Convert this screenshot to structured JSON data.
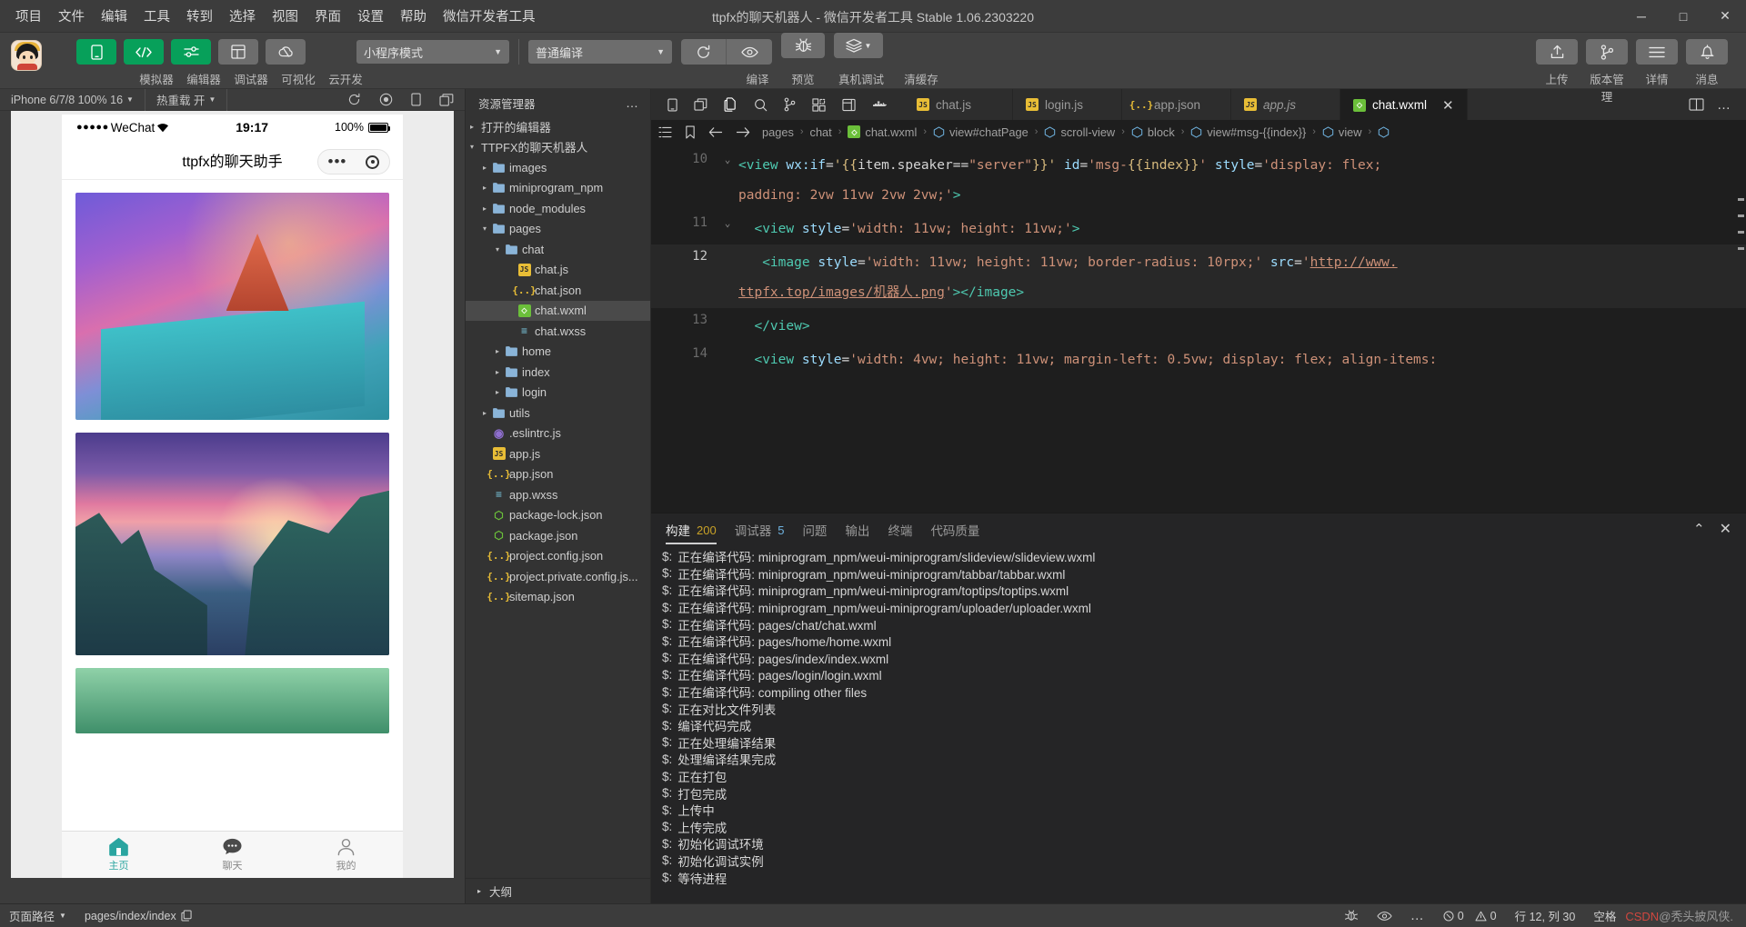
{
  "titlebar": {
    "menu": [
      "项目",
      "文件",
      "编辑",
      "工具",
      "转到",
      "选择",
      "视图",
      "界面",
      "设置",
      "帮助",
      "微信开发者工具"
    ],
    "title": "ttpfx的聊天机器人 - 微信开发者工具 Stable 1.06.2303220",
    "minimize": "─",
    "maximize": "□",
    "close": "✕"
  },
  "toolbar": {
    "left_buttons": [
      {
        "label": "模拟器",
        "icon": "phone-icon",
        "active": true
      },
      {
        "label": "编辑器",
        "icon": "code-icon",
        "active": true
      },
      {
        "label": "调试器",
        "icon": "sliders-icon",
        "active": true
      },
      {
        "label": "可视化",
        "icon": "layout-icon",
        "active": false
      },
      {
        "label": "云开发",
        "icon": "cloud-icon",
        "active": false
      }
    ],
    "mode_select": "小程序模式",
    "compile_select": "普通编译",
    "actions": [
      {
        "label": "编译",
        "icon": "refresh-icon"
      },
      {
        "label": "预览",
        "icon": "eye-icon"
      },
      {
        "label": "真机调试",
        "icon": "bug-icon"
      },
      {
        "label": "清缓存",
        "icon": "layers-icon"
      }
    ],
    "right_buttons": [
      {
        "label": "上传",
        "icon": "upload-icon"
      },
      {
        "label": "版本管理",
        "icon": "branch-icon"
      },
      {
        "label": "详情",
        "icon": "menu-icon"
      },
      {
        "label": "消息",
        "icon": "bell-icon"
      }
    ]
  },
  "simulator": {
    "device": "iPhone 6/7/8 100% 16",
    "hot_reload": "热重载 开",
    "refresh_icon": "refresh-icon",
    "record_icon": "record-icon",
    "rotate_icon": "rotate-icon",
    "multi_icon": "multiscreen-icon",
    "status": {
      "signal_dots": "●●●●●",
      "carrier": "WeChat",
      "wifi_icon": "wifi-icon",
      "time": "19:17",
      "battery": "100%"
    },
    "nav_title": "ttpfx的聊天助手",
    "capsule_more": "•••",
    "capsule_target": "target-icon",
    "tabs": [
      {
        "label": "主页",
        "icon": "home-icon",
        "active": true
      },
      {
        "label": "聊天",
        "icon": "chat-icon",
        "active": false
      },
      {
        "label": "我的",
        "icon": "user-icon",
        "active": false
      }
    ]
  },
  "explorer": {
    "title": "资源管理器",
    "more": "…",
    "open_editors": "打开的编辑器",
    "project": "TTPFX的聊天机器人",
    "outline": "大纲",
    "tree": [
      {
        "name": "images",
        "depth": 1,
        "type": "folder",
        "arrow": "▸"
      },
      {
        "name": "miniprogram_npm",
        "depth": 1,
        "type": "folder",
        "arrow": "▸"
      },
      {
        "name": "node_modules",
        "depth": 1,
        "type": "folder",
        "arrow": "▸"
      },
      {
        "name": "pages",
        "depth": 1,
        "type": "folder",
        "arrow": "▾"
      },
      {
        "name": "chat",
        "depth": 2,
        "type": "folder",
        "arrow": "▾"
      },
      {
        "name": "chat.js",
        "depth": 3,
        "type": "js",
        "arrow": ""
      },
      {
        "name": "chat.json",
        "depth": 3,
        "type": "json",
        "arrow": ""
      },
      {
        "name": "chat.wxml",
        "depth": 3,
        "type": "wxml",
        "arrow": "",
        "selected": true
      },
      {
        "name": "chat.wxss",
        "depth": 3,
        "type": "wxss",
        "arrow": ""
      },
      {
        "name": "home",
        "depth": 2,
        "type": "folder",
        "arrow": "▸"
      },
      {
        "name": "index",
        "depth": 2,
        "type": "folder",
        "arrow": "▸"
      },
      {
        "name": "login",
        "depth": 2,
        "type": "folder",
        "arrow": "▸"
      },
      {
        "name": "utils",
        "depth": 1,
        "type": "folder",
        "arrow": "▸"
      },
      {
        "name": ".eslintrc.js",
        "depth": 1,
        "type": "dot",
        "arrow": ""
      },
      {
        "name": "app.js",
        "depth": 1,
        "type": "js",
        "arrow": ""
      },
      {
        "name": "app.json",
        "depth": 1,
        "type": "json",
        "arrow": ""
      },
      {
        "name": "app.wxss",
        "depth": 1,
        "type": "wxss",
        "arrow": ""
      },
      {
        "name": "package-lock.json",
        "depth": 1,
        "type": "pkg",
        "arrow": ""
      },
      {
        "name": "package.json",
        "depth": 1,
        "type": "pkg",
        "arrow": ""
      },
      {
        "name": "project.config.json",
        "depth": 1,
        "type": "json",
        "arrow": ""
      },
      {
        "name": "project.private.config.js...",
        "depth": 1,
        "type": "json",
        "arrow": ""
      },
      {
        "name": "sitemap.json",
        "depth": 1,
        "type": "json",
        "arrow": ""
      }
    ]
  },
  "editor": {
    "activity_icons": [
      "phone-icon",
      "window-icon",
      "files-icon",
      "search-icon",
      "branch-icon",
      "extensions-icon",
      "debug-icon",
      "docker-icon"
    ],
    "tabs": [
      {
        "label": "chat.js",
        "type": "js",
        "active": false,
        "italic": false
      },
      {
        "label": "login.js",
        "type": "js",
        "active": false,
        "italic": false
      },
      {
        "label": "app.json",
        "type": "json",
        "active": false,
        "italic": false
      },
      {
        "label": "app.js",
        "type": "js",
        "active": false,
        "italic": true
      },
      {
        "label": "chat.wxml",
        "type": "wxml",
        "active": true,
        "italic": false,
        "close": "✕"
      }
    ],
    "tabstrip_icons": [
      "split-editor-icon",
      "more-icon"
    ],
    "breadcrumb_icons": [
      "outline-icon",
      "bookmark-icon",
      "back-icon",
      "forward-icon"
    ],
    "breadcrumb": [
      {
        "label": "pages",
        "icon": ""
      },
      {
        "label": "chat",
        "icon": ""
      },
      {
        "label": "chat.wxml",
        "icon": "wxml"
      },
      {
        "label": "view#chatPage",
        "icon": "symbol"
      },
      {
        "label": "scroll-view",
        "icon": "symbol"
      },
      {
        "label": "block",
        "icon": "symbol"
      },
      {
        "label": "view#msg-{{index}}",
        "icon": "symbol"
      },
      {
        "label": "view",
        "icon": "symbol"
      },
      {
        "label": "",
        "icon": "symbol"
      }
    ],
    "lines": [
      {
        "num": "10",
        "fold": "⌄",
        "current": false,
        "segments": [
          {
            "t": "<view ",
            "c": "tag"
          },
          {
            "t": "wx:if",
            "c": "attr"
          },
          {
            "t": "=",
            "c": "punct"
          },
          {
            "t": "'{{",
            "c": "brace"
          },
          {
            "t": "item.speaker==",
            "c": "white"
          },
          {
            "t": "\"server\"",
            "c": "str"
          },
          {
            "t": "}}'",
            "c": "brace"
          },
          {
            "t": " id",
            "c": "attr"
          },
          {
            "t": "=",
            "c": "punct"
          },
          {
            "t": "'msg-",
            "c": "str"
          },
          {
            "t": "{{index}}",
            "c": "brace"
          },
          {
            "t": "'",
            "c": "str"
          },
          {
            "t": " style",
            "c": "attr"
          },
          {
            "t": "=",
            "c": "punct"
          },
          {
            "t": "'display: flex;",
            "c": "str"
          }
        ],
        "wrap": [
          {
            "t": "padding: 2vw 11vw 2vw 2vw;'",
            "c": "str"
          },
          {
            "t": ">",
            "c": "tag"
          }
        ]
      },
      {
        "num": "11",
        "fold": "⌄",
        "current": false,
        "segments": [
          {
            "t": "  <view ",
            "c": "tag"
          },
          {
            "t": "style",
            "c": "attr"
          },
          {
            "t": "=",
            "c": "punct"
          },
          {
            "t": "'width: 11vw; height: 11vw;'",
            "c": "str"
          },
          {
            "t": ">",
            "c": "tag"
          }
        ],
        "wrap": []
      },
      {
        "num": "12",
        "fold": "",
        "current": true,
        "segments": [
          {
            "t": "   <image ",
            "c": "tag"
          },
          {
            "t": "style",
            "c": "attr"
          },
          {
            "t": "=",
            "c": "punct"
          },
          {
            "t": "'width: 11vw; height: 11vw; border-radius: 10rpx;'",
            "c": "str"
          },
          {
            "t": " src",
            "c": "attr"
          },
          {
            "t": "=",
            "c": "punct"
          },
          {
            "t": "'",
            "c": "str"
          },
          {
            "t": "http://www.",
            "c": "link"
          }
        ],
        "wrap": [
          {
            "t": "ttpfx.top/images/机器人.png",
            "c": "link"
          },
          {
            "t": "'",
            "c": "str"
          },
          {
            "t": "></image>",
            "c": "tag"
          }
        ]
      },
      {
        "num": "13",
        "fold": "",
        "current": false,
        "segments": [
          {
            "t": "  </view>",
            "c": "tag"
          }
        ],
        "wrap": []
      },
      {
        "num": "14",
        "fold": "",
        "current": false,
        "segments": [
          {
            "t": "  <view ",
            "c": "tag"
          },
          {
            "t": "style",
            "c": "attr"
          },
          {
            "t": "=",
            "c": "punct"
          },
          {
            "t": "'width: 4vw; height: 11vw; margin-left: 0.5vw; display: flex; align-items:",
            "c": "str"
          }
        ],
        "wrap": []
      }
    ]
  },
  "panel": {
    "tabs": [
      {
        "label": "构建",
        "count": "200",
        "active": true,
        "countColor": "gold"
      },
      {
        "label": "调试器",
        "count": "5",
        "active": false,
        "countColor": "blue"
      },
      {
        "label": "问题",
        "count": "",
        "active": false
      },
      {
        "label": "输出",
        "count": "",
        "active": false
      },
      {
        "label": "终端",
        "count": "",
        "active": false
      },
      {
        "label": "代码质量",
        "count": "",
        "active": false
      }
    ],
    "collapse_icon": "chevron-up-icon",
    "close_icon": "close-icon",
    "prefix": "$:",
    "logs": [
      "正在编译代码: miniprogram_npm/weui-miniprogram/slideview/slideview.wxml",
      "正在编译代码: miniprogram_npm/weui-miniprogram/tabbar/tabbar.wxml",
      "正在编译代码: miniprogram_npm/weui-miniprogram/toptips/toptips.wxml",
      "正在编译代码: miniprogram_npm/weui-miniprogram/uploader/uploader.wxml",
      "正在编译代码: pages/chat/chat.wxml",
      "正在编译代码: pages/home/home.wxml",
      "正在编译代码: pages/index/index.wxml",
      "正在编译代码: pages/login/login.wxml",
      "正在编译代码: compiling other files",
      "正在对比文件列表",
      "编译代码完成",
      "正在处理编译结果",
      "处理编译结果完成",
      "正在打包",
      "打包完成",
      "上传中",
      "上传完成",
      "初始化调试环境",
      "初始化调试实例",
      "等待进程"
    ]
  },
  "statusbar": {
    "page_path_label": "页面路径",
    "page_path": "pages/index/index",
    "copy_icon": "copy-icon",
    "debug_icon": "debug-icon",
    "eye_icon": "eye-icon",
    "more_icon": "more-icon",
    "errors": "0",
    "warnings": "0",
    "cursor": "行 12, 列 30",
    "encoding": "空格",
    "watermark_prefix": "CSDN",
    "watermark_author": "@秃头披风侠."
  }
}
